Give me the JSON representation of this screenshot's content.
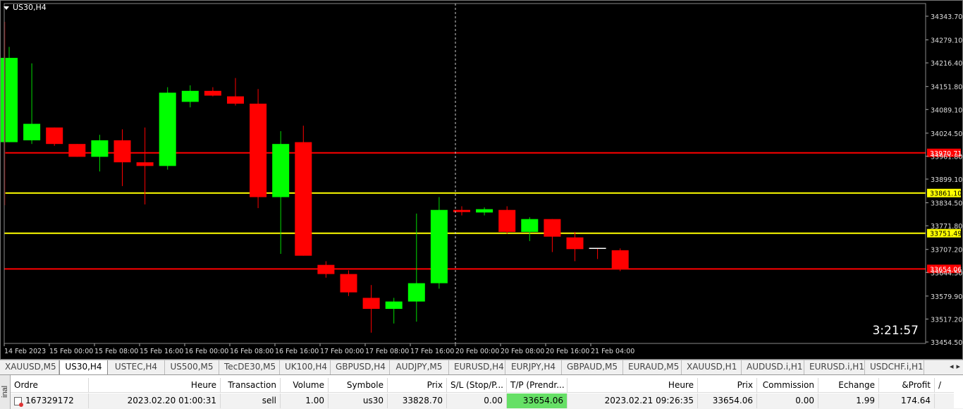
{
  "chart": {
    "title": "US30,H4",
    "countdown": "3:21:57",
    "price_axis": [
      "34343.70",
      "34279.10",
      "34216.40",
      "34151.80",
      "34089.10",
      "34024.50",
      "33961.80",
      "33899.10",
      "33834.50",
      "33771.80",
      "33707.20",
      "33644.50",
      "33579.90",
      "33517.20",
      "33454.50"
    ],
    "time_axis": [
      "14 Feb 2023",
      "15 Feb 00:00",
      "15 Feb 08:00",
      "15 Feb 16:00",
      "16 Feb 00:00",
      "16 Feb 08:00",
      "16 Feb 16:00",
      "17 Feb 00:00",
      "17 Feb 08:00",
      "17 Feb 16:00",
      "20 Feb 00:00",
      "20 Feb 08:00",
      "20 Feb 16:00",
      "21 Feb 04:00"
    ],
    "lines": [
      {
        "price": 33970.71,
        "label": "33970.71",
        "color": "#ff0000",
        "label_bg": "#ff0000",
        "label_fg": "#ffffff"
      },
      {
        "price": 33861.1,
        "label": "33861.10",
        "color": "#ffff00",
        "label_bg": "#ffff00",
        "label_fg": "#000000"
      },
      {
        "price": 33751.49,
        "label": "33751.49",
        "color": "#ffff00",
        "label_bg": "#ffff00",
        "label_fg": "#000000"
      },
      {
        "price": 33654.06,
        "label": "33654.06",
        "color": "#ff0000",
        "label_bg": "#ff0000",
        "label_fg": "#ffffff"
      }
    ],
    "colors": {
      "bull": "#00ff00",
      "bear": "#ff0000",
      "wick_bull": "#00dd00",
      "wick_bear": "#ff0000",
      "neutral": "#ffffff"
    }
  },
  "chart_data": {
    "type": "candlestick",
    "title": "US30,H4",
    "ylim": [
      33430,
      34360
    ],
    "candles": [
      {
        "o": 34000,
        "h": 34260,
        "l": 34000,
        "c": 34230
      },
      {
        "o": 34005,
        "h": 34215,
        "l": 33995,
        "c": 34050
      },
      {
        "o": 34040,
        "h": 34040,
        "l": 33990,
        "c": 33995
      },
      {
        "o": 33995,
        "h": 33995,
        "l": 33960,
        "c": 33960
      },
      {
        "o": 33960,
        "h": 34020,
        "l": 33920,
        "c": 34005
      },
      {
        "o": 34005,
        "h": 34035,
        "l": 33880,
        "c": 33945
      },
      {
        "o": 33945,
        "h": 34040,
        "l": 33830,
        "c": 33935
      },
      {
        "o": 33935,
        "h": 34150,
        "l": 33925,
        "c": 34135
      },
      {
        "o": 34110,
        "h": 34155,
        "l": 34095,
        "c": 34140
      },
      {
        "o": 34140,
        "h": 34150,
        "l": 34125,
        "c": 34127
      },
      {
        "o": 34125,
        "h": 34175,
        "l": 34100,
        "c": 34105
      },
      {
        "o": 34105,
        "h": 34145,
        "l": 33820,
        "c": 33850
      },
      {
        "o": 33850,
        "h": 34030,
        "l": 33695,
        "c": 33995
      },
      {
        "o": 34000,
        "h": 34045,
        "l": 33690,
        "c": 33690
      },
      {
        "o": 33665,
        "h": 33675,
        "l": 33630,
        "c": 33640
      },
      {
        "o": 33640,
        "h": 33650,
        "l": 33580,
        "c": 33590
      },
      {
        "o": 33575,
        "h": 33610,
        "l": 33480,
        "c": 33545
      },
      {
        "o": 33545,
        "h": 33575,
        "l": 33505,
        "c": 33565
      },
      {
        "o": 33565,
        "h": 33805,
        "l": 33510,
        "c": 33615
      },
      {
        "o": 33615,
        "h": 33850,
        "l": 33600,
        "c": 33815
      },
      {
        "o": 33815,
        "h": 33825,
        "l": 33800,
        "c": 33810
      },
      {
        "o": 33808,
        "h": 33822,
        "l": 33800,
        "c": 33817
      },
      {
        "o": 33815,
        "h": 33825,
        "l": 33750,
        "c": 33755
      },
      {
        "o": 33755,
        "h": 33795,
        "l": 33730,
        "c": 33790
      },
      {
        "o": 33790,
        "h": 33790,
        "l": 33700,
        "c": 33742
      },
      {
        "o": 33740,
        "h": 33755,
        "l": 33675,
        "c": 33708
      },
      {
        "o": 33710,
        "h": 33710,
        "l": 33681,
        "c": 33709
      },
      {
        "o": 33705,
        "h": 33710,
        "l": 33648,
        "c": 33654
      }
    ]
  },
  "tabs": [
    "XAUUSD,M5",
    "US30,H4",
    "USTEC,H4",
    "US500,M5",
    "TecDE30,M5",
    "UK100,H4",
    "GBPUSD,H4",
    "AUDJPY,M5",
    "EURUSD,H4",
    "EURJPY,H4",
    "GBPAUD,M5",
    "EURAUD,M5",
    "XAUUSD,H1",
    "AUDUSD.i,H1",
    "EURUSD.i,H1",
    "USDCHF.i,H1"
  ],
  "active_tab": 1,
  "tab_nav": {
    "left": "◂",
    "right": "▸"
  },
  "terminal": {
    "side_label": "inal",
    "headers": [
      "Ordre",
      "Heure",
      "Transaction",
      "Volume",
      "Symbole",
      "Prix",
      "S/L (Stop/P...",
      "T/P (Prendr...",
      "Heure",
      "Prix",
      "Commission",
      "Echange",
      "&Profit",
      "/"
    ],
    "row": {
      "ordre": "167329172",
      "heure": "2023.02.20 01:00:31",
      "transaction": "sell",
      "volume": "1.00",
      "symbole": "us30",
      "prix": "33828.70",
      "sl": "0.00",
      "tp": "33654.06",
      "heure2": "2023.02.21 09:26:35",
      "prix2": "33654.06",
      "commission": "0.00",
      "echange": "1.99",
      "profit": "174.64"
    }
  }
}
